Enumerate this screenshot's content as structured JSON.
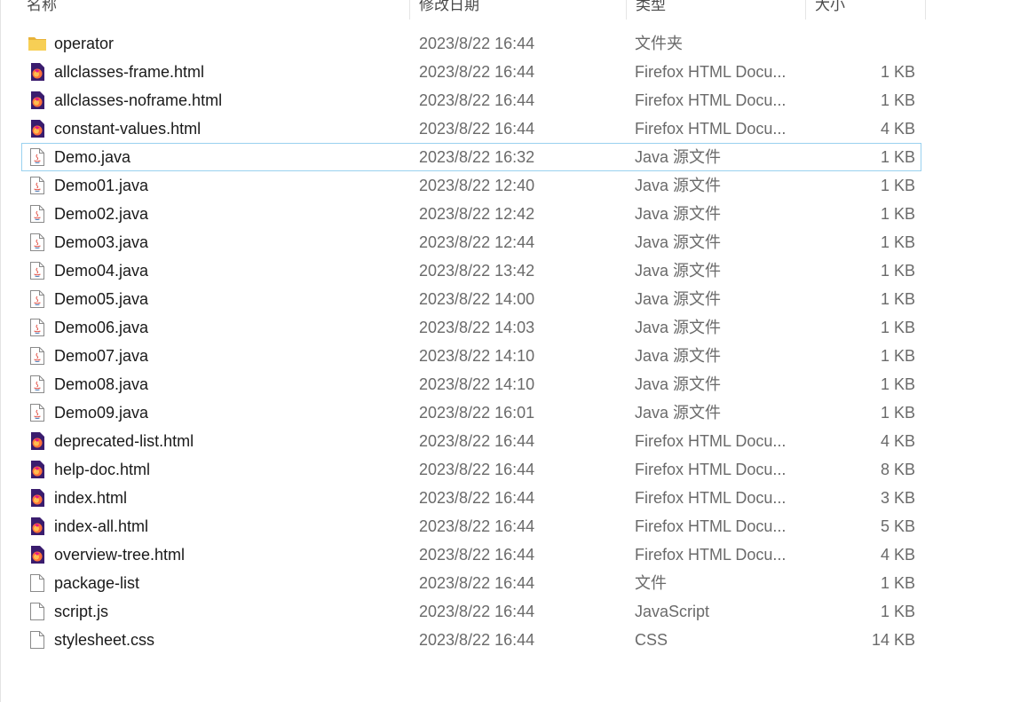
{
  "columns": {
    "name": "名称",
    "date": "修改日期",
    "type": "类型",
    "size": "大小"
  },
  "files": [
    {
      "name": "operator",
      "date": "2023/8/22 16:44",
      "type": "文件夹",
      "size": "",
      "icon": "folder-icon"
    },
    {
      "name": "allclasses-frame.html",
      "date": "2023/8/22 16:44",
      "type": "Firefox HTML Docu...",
      "size": "1 KB",
      "icon": "firefox-html-icon"
    },
    {
      "name": "allclasses-noframe.html",
      "date": "2023/8/22 16:44",
      "type": "Firefox HTML Docu...",
      "size": "1 KB",
      "icon": "firefox-html-icon"
    },
    {
      "name": "constant-values.html",
      "date": "2023/8/22 16:44",
      "type": "Firefox HTML Docu...",
      "size": "4 KB",
      "icon": "firefox-html-icon"
    },
    {
      "name": "Demo.java",
      "date": "2023/8/22 16:32",
      "type": "Java 源文件",
      "size": "1 KB",
      "icon": "java-file-icon",
      "focused": true
    },
    {
      "name": "Demo01.java",
      "date": "2023/8/22 12:40",
      "type": "Java 源文件",
      "size": "1 KB",
      "icon": "java-file-icon"
    },
    {
      "name": "Demo02.java",
      "date": "2023/8/22 12:42",
      "type": "Java 源文件",
      "size": "1 KB",
      "icon": "java-file-icon"
    },
    {
      "name": "Demo03.java",
      "date": "2023/8/22 12:44",
      "type": "Java 源文件",
      "size": "1 KB",
      "icon": "java-file-icon"
    },
    {
      "name": "Demo04.java",
      "date": "2023/8/22 13:42",
      "type": "Java 源文件",
      "size": "1 KB",
      "icon": "java-file-icon"
    },
    {
      "name": "Demo05.java",
      "date": "2023/8/22 14:00",
      "type": "Java 源文件",
      "size": "1 KB",
      "icon": "java-file-icon"
    },
    {
      "name": "Demo06.java",
      "date": "2023/8/22 14:03",
      "type": "Java 源文件",
      "size": "1 KB",
      "icon": "java-file-icon"
    },
    {
      "name": "Demo07.java",
      "date": "2023/8/22 14:10",
      "type": "Java 源文件",
      "size": "1 KB",
      "icon": "java-file-icon"
    },
    {
      "name": "Demo08.java",
      "date": "2023/8/22 14:10",
      "type": "Java 源文件",
      "size": "1 KB",
      "icon": "java-file-icon"
    },
    {
      "name": "Demo09.java",
      "date": "2023/8/22 16:01",
      "type": "Java 源文件",
      "size": "1 KB",
      "icon": "java-file-icon"
    },
    {
      "name": "deprecated-list.html",
      "date": "2023/8/22 16:44",
      "type": "Firefox HTML Docu...",
      "size": "4 KB",
      "icon": "firefox-html-icon"
    },
    {
      "name": "help-doc.html",
      "date": "2023/8/22 16:44",
      "type": "Firefox HTML Docu...",
      "size": "8 KB",
      "icon": "firefox-html-icon"
    },
    {
      "name": "index.html",
      "date": "2023/8/22 16:44",
      "type": "Firefox HTML Docu...",
      "size": "3 KB",
      "icon": "firefox-html-icon"
    },
    {
      "name": "index-all.html",
      "date": "2023/8/22 16:44",
      "type": "Firefox HTML Docu...",
      "size": "5 KB",
      "icon": "firefox-html-icon"
    },
    {
      "name": "overview-tree.html",
      "date": "2023/8/22 16:44",
      "type": "Firefox HTML Docu...",
      "size": "4 KB",
      "icon": "firefox-html-icon"
    },
    {
      "name": "package-list",
      "date": "2023/8/22 16:44",
      "type": "文件",
      "size": "1 KB",
      "icon": "blank-file-icon"
    },
    {
      "name": "script.js",
      "date": "2023/8/22 16:44",
      "type": "JavaScript",
      "size": "1 KB",
      "icon": "blank-file-icon"
    },
    {
      "name": "stylesheet.css",
      "date": "2023/8/22 16:44",
      "type": "CSS",
      "size": "14 KB",
      "icon": "blank-file-icon"
    }
  ],
  "colors": {
    "focus_border": "#99d1ef",
    "folder": "#f4c94f",
    "firefox_orange": "#ff7139",
    "firefox_purple": "#5b2a86",
    "secondary_text": "#6a6a6a"
  }
}
